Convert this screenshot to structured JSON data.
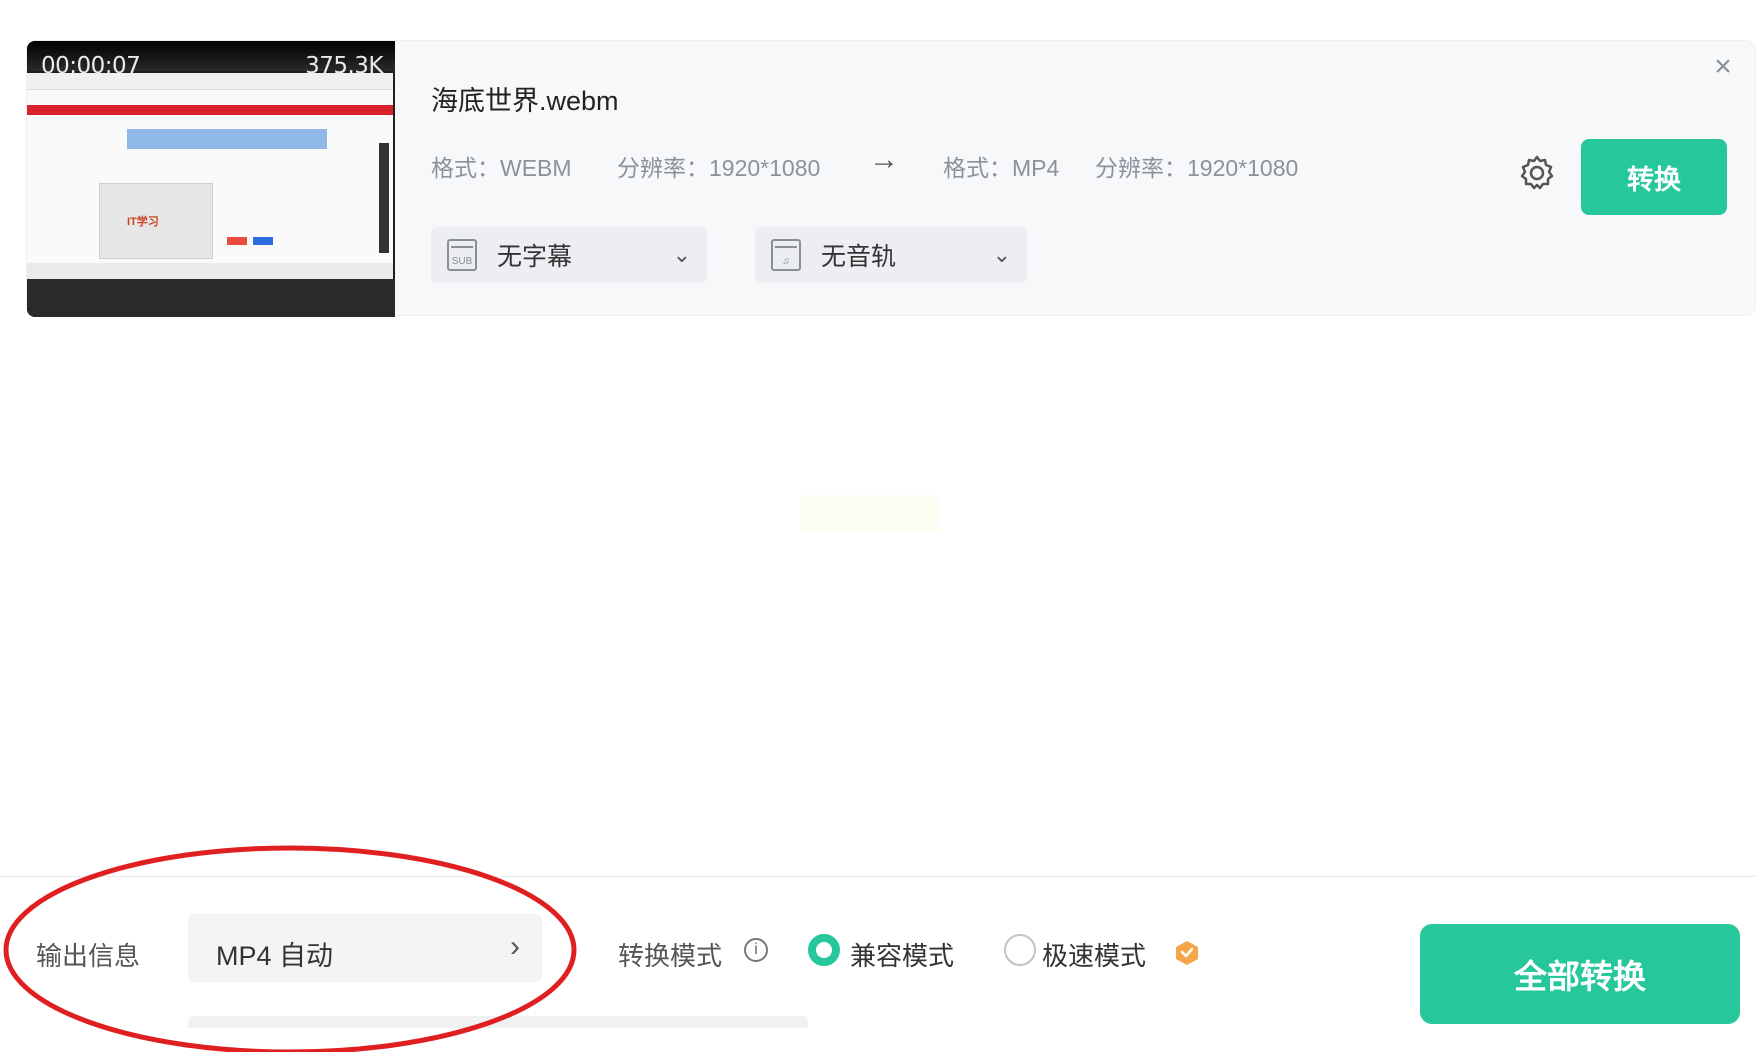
{
  "file": {
    "thumbnail": {
      "duration": "00:00:07",
      "size": "375.3K",
      "logo_text": "IT学习"
    },
    "name": "海底世界.webm",
    "source": {
      "format_label": "格式：",
      "format": "WEBM",
      "resolution_label": "分辨率：",
      "resolution": "1920*1080"
    },
    "target": {
      "format_label": "格式：",
      "format": "MP4",
      "resolution_label": "分辨率：",
      "resolution": "1920*1080"
    },
    "arrow_icon": "arrow-right-icon",
    "subtitle_select": {
      "value": "无字幕",
      "icon_text": "SUB"
    },
    "audio_select": {
      "value": "无音轨"
    },
    "convert_label": "转换"
  },
  "bottom": {
    "output_label": "输出信息",
    "output_value": "MP4 自动",
    "mode_label": "转换模式",
    "modes": [
      {
        "label": "兼容模式",
        "selected": true
      },
      {
        "label": "极速模式",
        "selected": false
      }
    ],
    "convert_all_label": "全部转换"
  },
  "colors": {
    "accent": "#26c79a",
    "annotation": "#e02020",
    "vip": "#f5a54a"
  }
}
